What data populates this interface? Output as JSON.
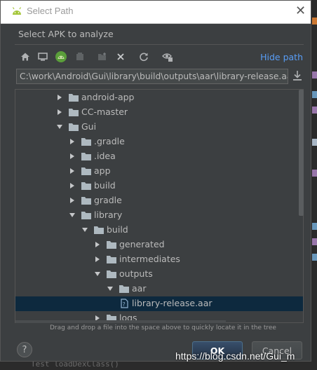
{
  "window": {
    "title": "Select Path"
  },
  "subtitle": "Select APK to analyze",
  "toolbar": {
    "icons": [
      "home-icon",
      "desktop-icon",
      "android-icon",
      "module-icon",
      "new-folder-icon",
      "delete-icon",
      "refresh-icon",
      "show-hidden-icon"
    ],
    "hide_path": "Hide path"
  },
  "path": {
    "value": "C:\\work\\Android\\Gui\\library\\build\\outputs\\aar\\library-release.aar"
  },
  "tree": {
    "rows": [
      {
        "label": "android-app",
        "expanded": false
      },
      {
        "label": "CC-master",
        "expanded": false
      },
      {
        "label": "Gui",
        "expanded": true
      },
      {
        "label": ".gradle",
        "expanded": false
      },
      {
        "label": ".idea",
        "expanded": false
      },
      {
        "label": "app",
        "expanded": false
      },
      {
        "label": "build",
        "expanded": false
      },
      {
        "label": "gradle",
        "expanded": false
      },
      {
        "label": "library",
        "expanded": true
      },
      {
        "label": "build",
        "expanded": true
      },
      {
        "label": "generated",
        "expanded": false
      },
      {
        "label": "intermediates",
        "expanded": false
      },
      {
        "label": "outputs",
        "expanded": true
      },
      {
        "label": "aar",
        "expanded": true
      },
      {
        "label": "library-release.aar",
        "selected": true
      },
      {
        "label": "logs",
        "expanded": false
      }
    ]
  },
  "hint": "Drag and drop a file into the space above to quickly locate it in the tree",
  "buttons": {
    "help": "?",
    "ok": "OK",
    "cancel": "Cancel"
  },
  "background": {
    "editor_text": "Test    loadDexClass()"
  },
  "watermark": "https://blog.csdn.net/Gui_m",
  "colors": {
    "accent": "#589df6",
    "selection": "#0d293e",
    "background": "#3c3f41",
    "folder": "#aeb9c0"
  }
}
